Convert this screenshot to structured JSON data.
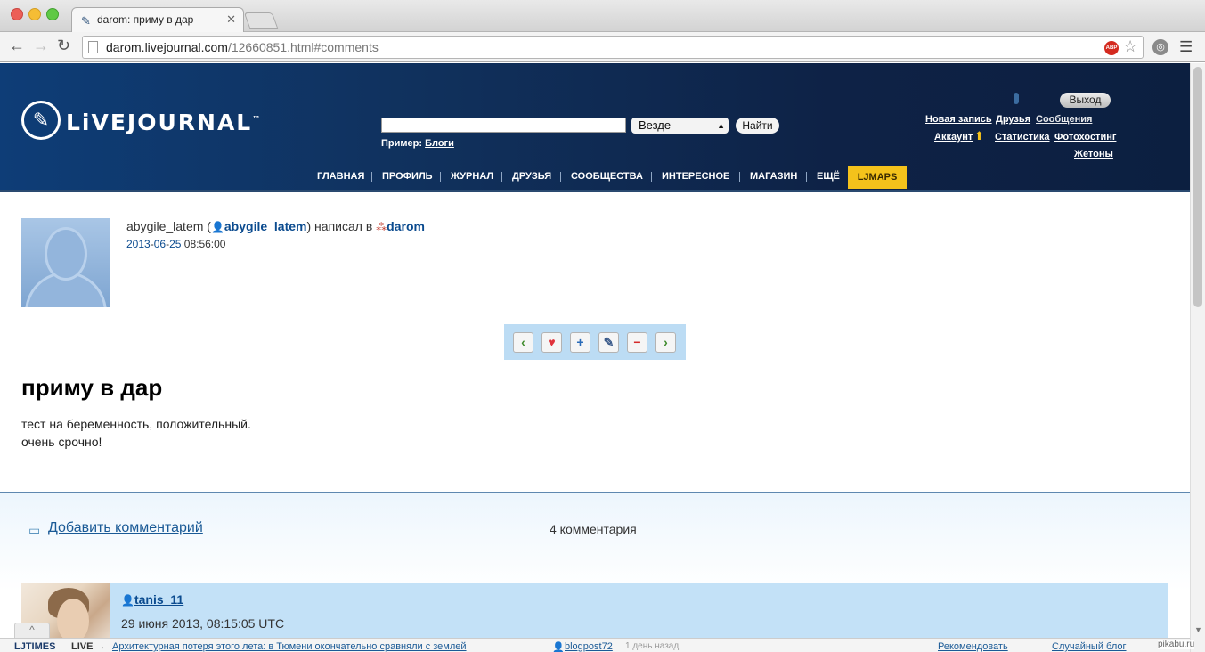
{
  "browser": {
    "tab_title": "darom: приму в дар",
    "tab_close": "✕",
    "url_domain": "darom.livejournal.com",
    "url_path": "/12660851.html#comments",
    "adblock": "ABP"
  },
  "header": {
    "logo_text": "LiVEJOURNAL",
    "logo_tm": "™",
    "search_scope": "Везде",
    "search_button": "Найти",
    "example_label": "Пример:",
    "example_link": "Блоги",
    "logout": "Выход",
    "links": {
      "new_post": "Новая запись",
      "friends": "Друзья",
      "messages": "Сообщения",
      "account": "Аккаунт",
      "stats": "Статистика",
      "photo": "Фотохостинг",
      "tokens": "Жетоны"
    },
    "nav": [
      "ГЛАВНАЯ",
      "ПРОФИЛЬ",
      "ЖУРНАЛ",
      "ДРУЗЬЯ",
      "СООБЩЕСТВА",
      "ИНТЕРЕСНОЕ",
      "МАГАЗИН",
      "ЕЩЁ"
    ],
    "ljmaps": "LJMAPS"
  },
  "entry": {
    "author_plain": "abygile_latem (",
    "author_link": "abygile_latem",
    "wrote_in": ") написал в",
    "community": "darom",
    "date_year": "2013",
    "date_month": "06",
    "date_day": "25",
    "time": "08:56:00",
    "title": "приму в дар",
    "body_line1": "тест на беременность, положительный.",
    "body_line2": "очень срочно!"
  },
  "actions": {
    "prev": "‹",
    "fave": "♥",
    "add": "+",
    "tag": "✎",
    "remove": "−",
    "next": "›"
  },
  "comments": {
    "add_label": "Добавить комментарий",
    "count_label": "4 комментария",
    "first": {
      "user": "tanis_11",
      "date": "29 июня 2013, 08:15:05 UTC"
    }
  },
  "bottom_bar": {
    "ljtimes": "LJTIMES",
    "live": "LIVE →",
    "headline": "Архитектурная потеря этого лета: в Тюмени окончательно сравняли с землей",
    "author": "blogpost72",
    "ago": "1 день назад",
    "recommend": "Рекомендовать",
    "random": "Случайный блог",
    "up": "^"
  },
  "watermark": "pikabu.ru"
}
